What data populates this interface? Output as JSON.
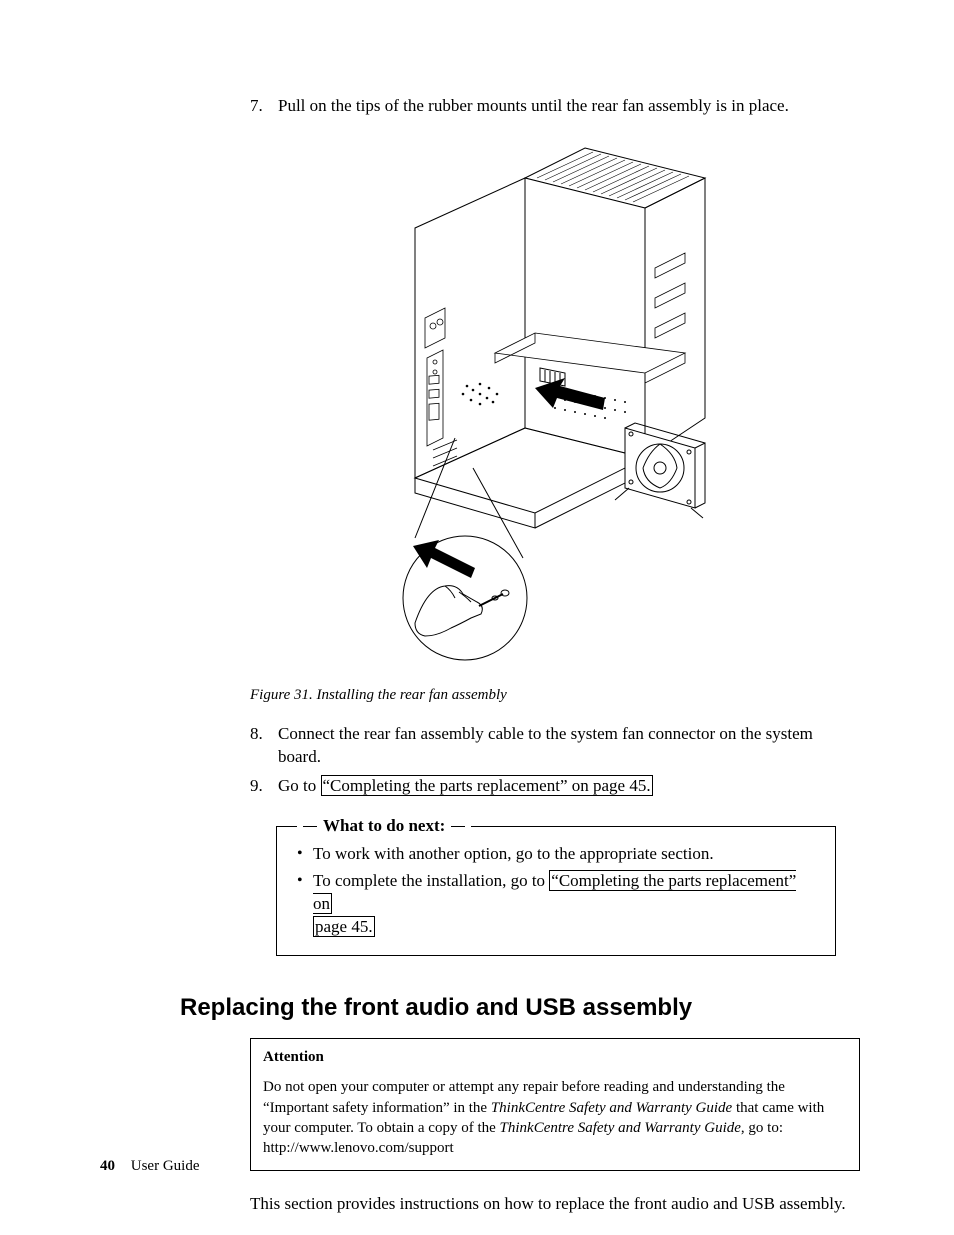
{
  "steps": {
    "s7": {
      "num": "7.",
      "text": "Pull on the tips of the rubber mounts until the rear fan assembly is in place."
    },
    "s8": {
      "num": "8.",
      "text": "Connect the rear fan assembly cable to the system fan connector on the system board."
    },
    "s9": {
      "num": "9.",
      "prefix": "Go to ",
      "link": "“Completing the parts replacement” on page 45."
    }
  },
  "figure": {
    "caption": "Figure 31. Installing the rear fan assembly"
  },
  "whatnext": {
    "title": "What to do next:",
    "items": [
      {
        "text": "To work with another option, go to the appropriate section."
      },
      {
        "prefix": "To complete the installation, go to ",
        "link1": "“Completing the parts replacement” on",
        "link2": "page 45."
      }
    ]
  },
  "section_heading": "Replacing the front audio and USB assembly",
  "attention": {
    "title": "Attention",
    "p1a": "Do not open your computer or attempt any repair before reading and understanding the “Important safety information” in the ",
    "p1b": "ThinkCentre Safety and Warranty Guide",
    "p1c": " that came with your computer. To obtain a copy of the ",
    "p1d": "ThinkCentre Safety and Warranty Guide",
    "p1e": ", go to:",
    "url": "http://www.lenovo.com/support"
  },
  "intro": "This section provides instructions on how to replace the front audio and USB assembly.",
  "footer": {
    "page": "40",
    "title": "User Guide"
  }
}
